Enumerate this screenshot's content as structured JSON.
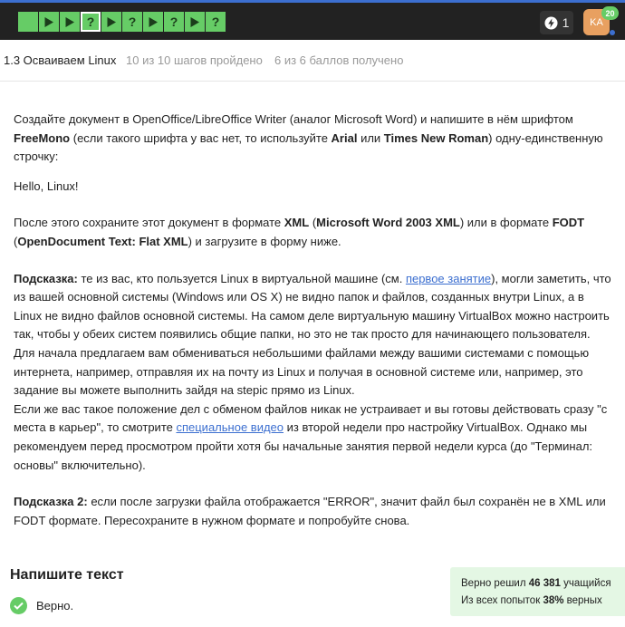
{
  "topbar": {
    "steps": [
      {
        "type": "text",
        "state": "done"
      },
      {
        "type": "play",
        "state": "done"
      },
      {
        "type": "play",
        "state": "done"
      },
      {
        "type": "quiz",
        "state": "done",
        "current": true
      },
      {
        "type": "play",
        "state": "done"
      },
      {
        "type": "quiz",
        "state": "done"
      },
      {
        "type": "play",
        "state": "done"
      },
      {
        "type": "quiz",
        "state": "done"
      },
      {
        "type": "play",
        "state": "done"
      },
      {
        "type": "quiz",
        "state": "done"
      }
    ],
    "step_icon_glyphs": {
      "quiz": "?"
    },
    "energy_icon": "lightning-icon",
    "energy_count": "1",
    "avatar_initials": "KA",
    "notification_count": "20",
    "colors": {
      "bar": "#222222",
      "accent": "#3c6fd0",
      "step_done": "#66cc66",
      "avatar": "#e8a060"
    }
  },
  "lesson": {
    "title": "1.3 Осваиваем Linux",
    "steps_done": "10 из 10 шагов пройдено",
    "points": "6 из 6 баллов  получено"
  },
  "content": {
    "p1": {
      "t1": "Создайте документ в OpenOffice/LibreOffice Writer (аналог Microsoft Word) и напишите в нём шрифтом ",
      "b1": "FreeMono",
      "t2": " (если такого шрифта у вас нет, то используйте ",
      "b2": "Arial",
      "t3": " или ",
      "b3": "Times New Roman",
      "t4": ") одну-единственную строчку:"
    },
    "p2": "Hello, Linux!",
    "p3": {
      "t1": "После этого сохраните этот документ в формате ",
      "b1": "XML",
      "t2": " (",
      "b2": "Microsoft Word 2003 XML",
      "t3": ") или в формате ",
      "b3": "FODT",
      "t4": " (",
      "b4": "OpenDocument Text: Flat XML",
      "t5": ") и загрузите в форму ниже."
    },
    "p4": {
      "b1": "Подсказка:",
      "t1": " те из вас, кто пользуется Linux в виртуальной машине (см. ",
      "link": "первое занятие",
      "t2": "), могли заметить, что из вашей основной системы (Windows или OS X) не видно папок и файлов, созданных внутри Linux, а в Linux не видно файлов основной системы. На самом деле виртуальную машину VirtualBox можно настроить так, чтобы у обеих систем появились общие папки, но это не так просто для начинающего пользователя. Для начала предлагаем вам обмениваться небольшими файлами между вашими системами с помощью интернета, например, отправляя их на почту из Linux и получая в основной системе или, например, это задание вы можете выполнить зайдя на stepic прямо из Linux."
    },
    "p5": {
      "t1": "Если же вас такое положение дел с обменом файлов никак не устраивает и вы готовы действовать сразу \"с места в карьер\", то смотрите ",
      "link": "специальное видео",
      "t2": " из второй недели про настройку VirtualBox. Однако мы рекомендуем перед просмотром пройти хотя бы начальные занятия первой недели курса (до \"Терминал: основы\" включительно)."
    },
    "p6": {
      "b1": "Подсказка 2:",
      "t1": " если после загрузки файла отображается \"ERROR\", значит файл был сохранён не в XML или FODT формате. Пересохраните в нужном формате и попробуйте снова."
    }
  },
  "answer": {
    "title": "Напишите текст",
    "verdict": "Верно.",
    "verdict_icon": "check-icon"
  },
  "stats": {
    "line1_pre": "Верно решил ",
    "line1_num": "46 381",
    "line1_post": " учащийся",
    "line2_pre": "Из всех попыток ",
    "line2_num": "38%",
    "line2_post": " верных"
  }
}
